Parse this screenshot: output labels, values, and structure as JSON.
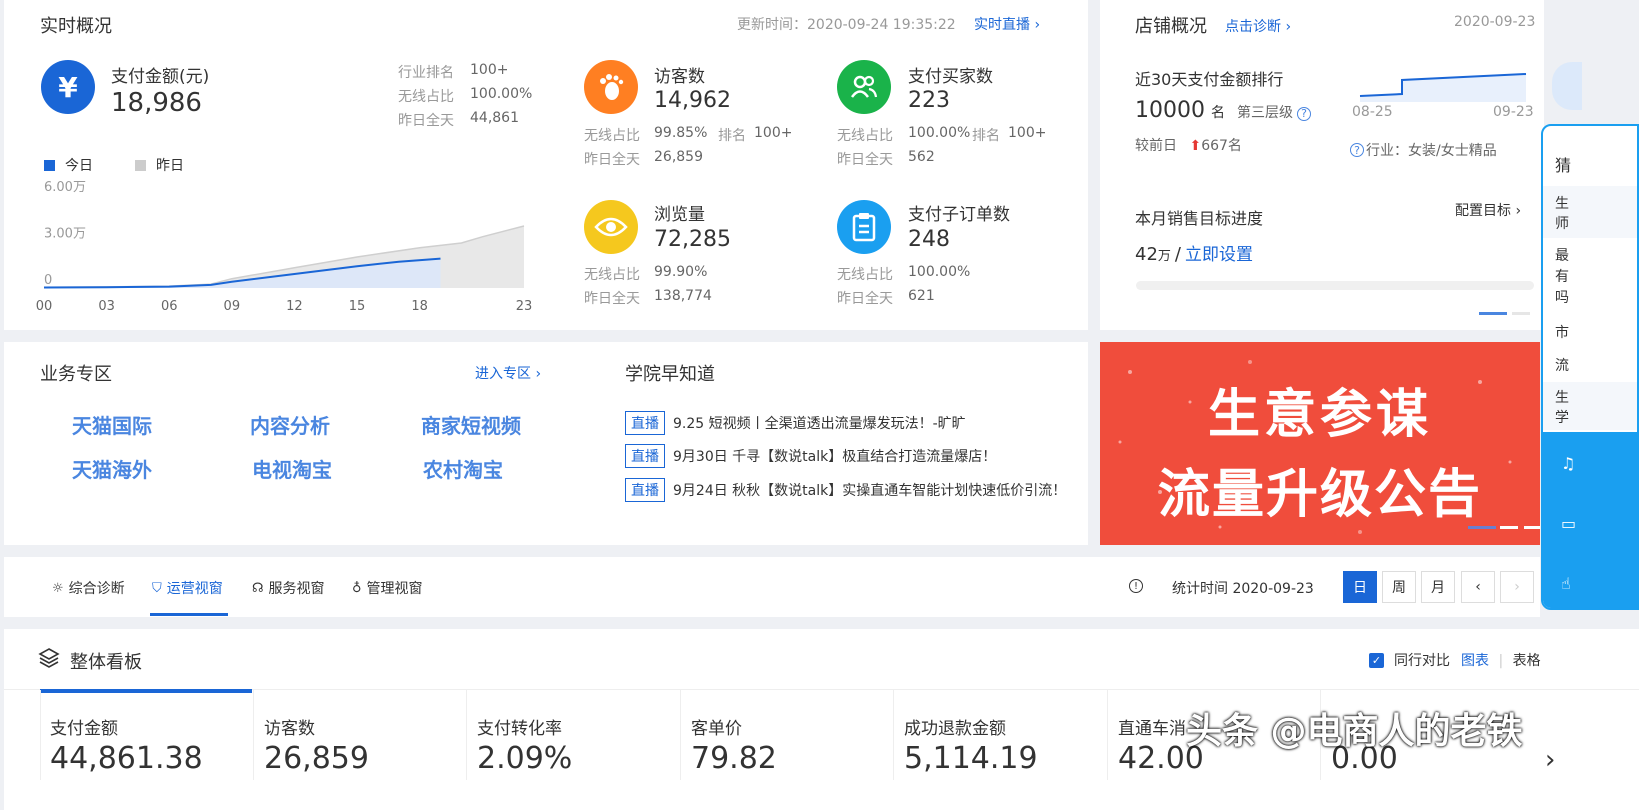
{
  "realtime": {
    "title": "实时概况",
    "update_label": "更新时间：2020-09-24 19:35:22",
    "live_link": "实时直播",
    "pay_amount": {
      "label": "支付金额(元)",
      "value": "18,986",
      "rank_label": "行业排名",
      "rank_value": "100+",
      "wireless_label": "无线占比",
      "wireless_value": "100.00%",
      "yday_label": "昨日全天",
      "yday_value": "44,861"
    },
    "legend_today": "今日",
    "legend_yesterday": "昨日",
    "visitors": {
      "label": "访客数",
      "value": "14,962",
      "wl_label": "无线占比",
      "wl_value": "99.85%",
      "rank_label": "排名",
      "rank_value": "100+",
      "yd_label": "昨日全天",
      "yd_value": "26,859"
    },
    "buyers": {
      "label": "支付买家数",
      "value": "223",
      "wl_label": "无线占比",
      "wl_value": "100.00%",
      "rank_label": "排名",
      "rank_value": "100+",
      "yd_label": "昨日全天",
      "yd_value": "562"
    },
    "pageviews": {
      "label": "浏览量",
      "value": "72,285",
      "wl_label": "无线占比",
      "wl_value": "99.90%",
      "yd_label": "昨日全天",
      "yd_value": "138,774"
    },
    "suborders": {
      "label": "支付子订单数",
      "value": "248",
      "wl_label": "无线占比",
      "wl_value": "100.00%",
      "yd_label": "昨日全天",
      "yd_value": "621"
    }
  },
  "chart_data": {
    "type": "area",
    "x": [
      "00",
      "03",
      "06",
      "09",
      "12",
      "15",
      "18",
      "23"
    ],
    "yticks": [
      "6.00万",
      "3.00万",
      "0"
    ],
    "ylim": [
      0,
      60000
    ],
    "series": [
      {
        "name": "昨日",
        "x_hours": [
          0,
          3,
          6,
          8,
          9,
          12,
          15,
          18,
          20,
          21,
          23
        ],
        "values": [
          500,
          700,
          1200,
          2500,
          6000,
          13000,
          20000,
          26000,
          29000,
          33000,
          40000
        ]
      },
      {
        "name": "今日",
        "x_hours": [
          0,
          3,
          6,
          8,
          9,
          12,
          15,
          17,
          19
        ],
        "values": [
          300,
          500,
          900,
          2000,
          4000,
          9000,
          14000,
          17000,
          18986
        ]
      }
    ]
  },
  "store": {
    "title": "店铺概况",
    "diagnose_link": "点击诊断",
    "date": "2020-09-23",
    "rank30_label": "近30天支付金额排行",
    "rank_value": "10000",
    "rank_unit": "名",
    "level": "第三层级",
    "vs_label": "较前日",
    "vs_value": "667名",
    "date_start": "08-25",
    "date_end": "09-23",
    "industry": "行业：女装/女士精品",
    "target_label": "本月销售目标进度",
    "config_link": "配置目标",
    "target_value": "42",
    "target_unit": "万",
    "set_link": "立即设置"
  },
  "business": {
    "title": "业务专区",
    "enter_link": "进入专区",
    "links": [
      "天猫国际",
      "内容分析",
      "商家短视频",
      "天猫海外",
      "电视淘宝",
      "农村淘宝"
    ]
  },
  "academy": {
    "title": "学院早知道",
    "tag": "直播",
    "items": [
      "9.25 短视频丨全渠道透出流量爆发玩法！-旷旷",
      "9月30日 千寻【数说talk】极直结合打造流量爆店！",
      "9月24日 秋秋【数说talk】实操直通车智能计划快速低价引流！"
    ]
  },
  "banner": {
    "line1": "生意参谋",
    "line2": "流量升级公告"
  },
  "side_panel": {
    "c1": "猜",
    "c2": "生",
    "c3": "师",
    "c4": "最",
    "c5": "有",
    "c6": "吗",
    "c7": "市",
    "c8": "流",
    "c9": "生",
    "c10": "学"
  },
  "tabs": {
    "items": [
      "综合诊断",
      "运营视窗",
      "服务视窗",
      "管理视窗"
    ],
    "stat_time": "统计时间 2020-09-23",
    "day": "日",
    "week": "周",
    "month": "月"
  },
  "dashboard": {
    "title": "整体看板",
    "compare": "同行对比",
    "chart_view": "图表",
    "table_view": "表格",
    "metrics": [
      {
        "label": "支付金额",
        "value": "44,861.38"
      },
      {
        "label": "访客数",
        "value": "26,859"
      },
      {
        "label": "支付转化率",
        "value": "2.09%"
      },
      {
        "label": "客单价",
        "value": "79.82"
      },
      {
        "label": "成功退款金额",
        "value": "5,114.19"
      },
      {
        "label": "直通车消",
        "value": "42.00"
      },
      {
        "label": "",
        "value": "0.00"
      }
    ],
    "watermark": "头条 @电商人的老铁"
  },
  "colors": {
    "accent": "#1a66d6",
    "orange": "#ff7f22",
    "green": "#1ab34a",
    "yellow": "#f5c81e",
    "banner_red": "#f04d3c"
  }
}
